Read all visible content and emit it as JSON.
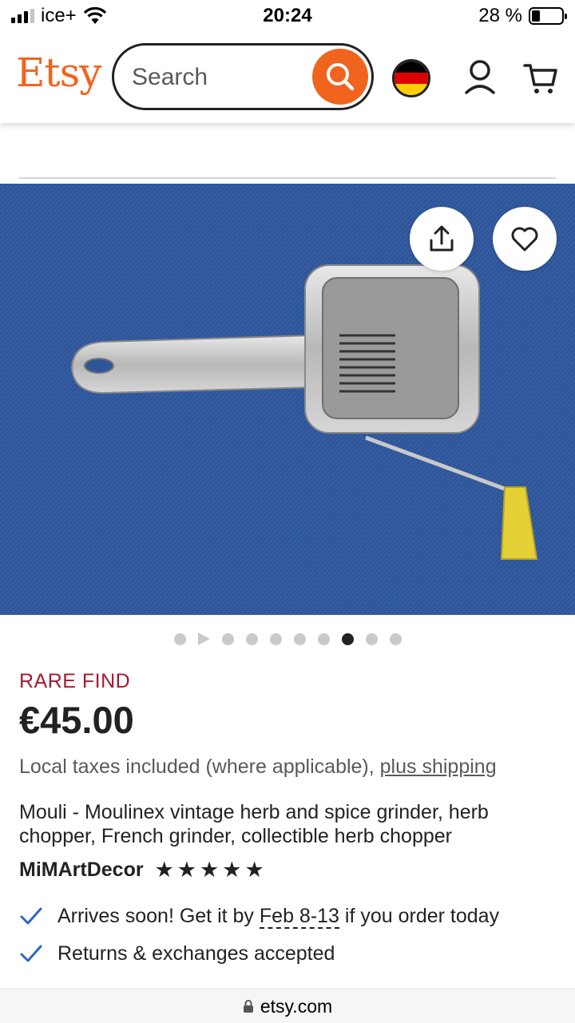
{
  "status_bar": {
    "carrier": "ice+",
    "time": "20:24",
    "battery_percent": "28 %",
    "battery_level": 0.28
  },
  "header": {
    "logo": "Etsy",
    "search_placeholder": "Search",
    "icons": [
      "search-icon",
      "germany-flag-icon",
      "account-icon",
      "cart-icon"
    ]
  },
  "gallery": {
    "image_description_icons": [
      "share-icon",
      "heart-icon"
    ],
    "image_count": 10,
    "active_index": 7,
    "video_index": 1
  },
  "listing": {
    "badge": "RARE FIND",
    "price": "€45.00",
    "taxes_text": "Local taxes included (where applicable),",
    "shipping_link": "plus shipping",
    "title": "Mouli - Moulinex vintage herb and spice grinder, herb chopper, French grinder, collectible herb chopper",
    "shop_name": "MiMArtDecor",
    "rating_stars": 5,
    "arrival_prefix": "Arrives soon! Get it by",
    "arrival_dates": "Feb 8-13",
    "arrival_suffix": "if you order today",
    "returns": "Returns & exchanges accepted"
  },
  "browser": {
    "url": "etsy.com"
  },
  "colors": {
    "brand": "#f1641e",
    "rare_find": "#a61a2e",
    "check": "#2f66c7",
    "image_bg": "#2f5599"
  }
}
